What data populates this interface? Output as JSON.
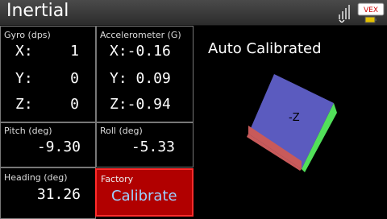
{
  "header": {
    "title": "Inertial",
    "signal_icon": "signal-bars-icon",
    "brand_label": "VEX",
    "battery_icon": "battery-icon"
  },
  "gyro": {
    "label": "Gyro (dps)",
    "x_axis": "X:",
    "x": "1",
    "y_axis": "Y:",
    "y": "0",
    "z_axis": "Z:",
    "z": "0"
  },
  "accel": {
    "label": "Accelerometer (G)",
    "x": "X:-0.16",
    "y": "Y: 0.09",
    "z": "Z:-0.94"
  },
  "pitch": {
    "label": "Pitch (deg)",
    "value": "-9.30"
  },
  "roll": {
    "label": "Roll (deg)",
    "value": "-5.33"
  },
  "heading": {
    "label": "Heading (deg)",
    "value": "31.26"
  },
  "calibrate_button": {
    "small": "Factory",
    "big": "Calibrate",
    "color": "#b10000"
  },
  "status": "Auto Calibrated",
  "orientation_cube": {
    "face_label": "-Z",
    "top_color": "#5b5bbf",
    "left_color": "#c85a5a",
    "right_color": "#52e05a"
  }
}
